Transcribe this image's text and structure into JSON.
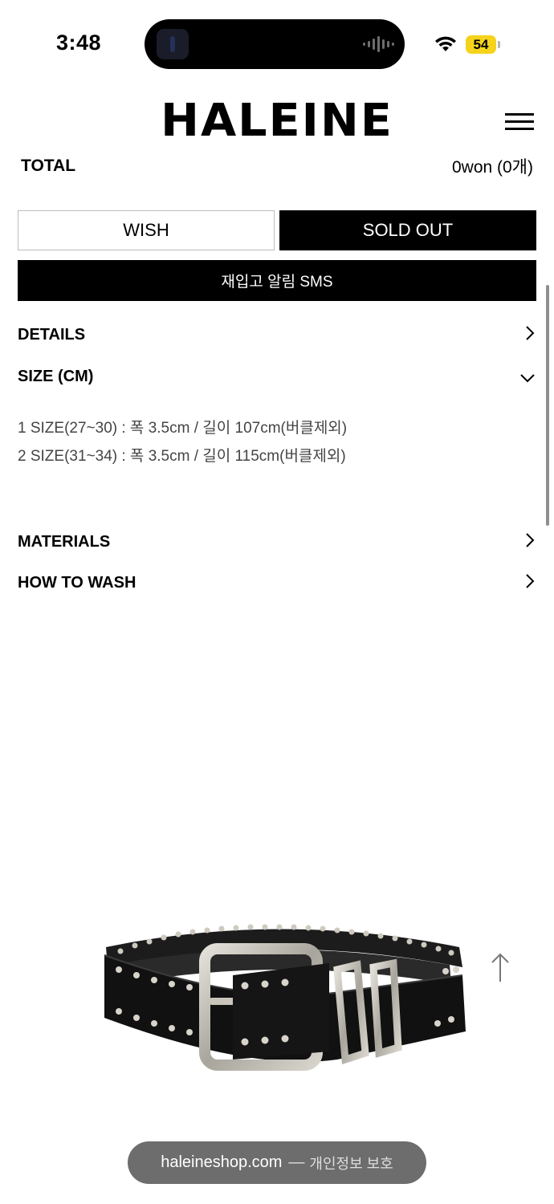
{
  "status_bar": {
    "time": "3:48",
    "battery": "54",
    "icons": [
      "wifi-icon",
      "battery-icon"
    ]
  },
  "header": {
    "logo": "HALEINE",
    "menu_icon": "hamburger-menu-icon"
  },
  "total": {
    "label": "TOTAL",
    "value": "0won (0개)"
  },
  "buttons": {
    "wish": "WISH",
    "sold_out": "SOLD OUT",
    "restock_sms": "재입고 알림 SMS"
  },
  "sections": {
    "details": "DETAILS",
    "size": "SIZE (CM)",
    "materials": "MATERIALS",
    "how_to_wash": "HOW TO WASH"
  },
  "size_info": [
    "1 SIZE(27~30) : 폭 3.5cm / 길이 107cm(버클제외)",
    "2 SIZE(31~34) : 폭 3.5cm / 길이 115cm(버클제외)"
  ],
  "bottom_bar": {
    "domain": "haleineshop.com",
    "separator": "—",
    "privacy": "개인정보 보호"
  },
  "colors": {
    "primary": "#000000",
    "background": "#ffffff",
    "battery": "#f5d31c",
    "pill": "#6d6d6d"
  }
}
